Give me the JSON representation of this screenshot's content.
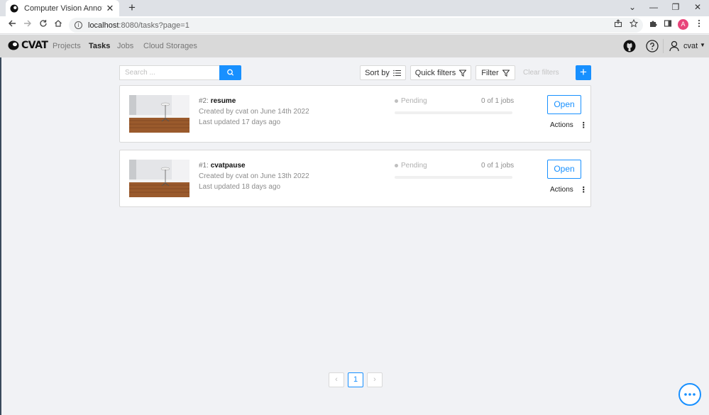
{
  "browser": {
    "tab_title": "Computer Vision Annotation Tool",
    "tab_close": "✕",
    "new_tab": "+",
    "url_host": "localhost",
    "url_rest": ":8080/tasks?page=1",
    "profile_initial": "A",
    "window_controls": [
      "⌄",
      "—",
      "❐",
      "✕"
    ]
  },
  "header": {
    "logo": "CVAT",
    "nav": [
      "Projects",
      "Tasks",
      "Jobs",
      "Cloud Storages"
    ],
    "active_nav": "Tasks",
    "user": "cvat"
  },
  "toolbar": {
    "search_placeholder": "Search ...",
    "sort_by": "Sort by",
    "quick_filters": "Quick filters",
    "filter": "Filter",
    "clear_filters": "Clear filters",
    "create": "+"
  },
  "tasks": [
    {
      "id_label": "#2: ",
      "name": "resume",
      "created": "Created by cvat on June 14th 2022",
      "updated": "Last updated 17 days ago",
      "status": "Pending",
      "jobs": "0 of 1 jobs",
      "progress": 0,
      "open": "Open",
      "actions": "Actions"
    },
    {
      "id_label": "#1: ",
      "name": "cvatpause",
      "created": "Created by cvat on June 13th 2022",
      "updated": "Last updated 18 days ago",
      "status": "Pending",
      "jobs": "0 of 1 jobs",
      "progress": 0,
      "open": "Open",
      "actions": "Actions"
    }
  ],
  "pagination": {
    "prev": "‹",
    "current": "1",
    "next": "›"
  },
  "colors": {
    "accent": "#1890ff",
    "header_bg": "#d9d9d9",
    "page_bg": "#f1f2f5"
  }
}
